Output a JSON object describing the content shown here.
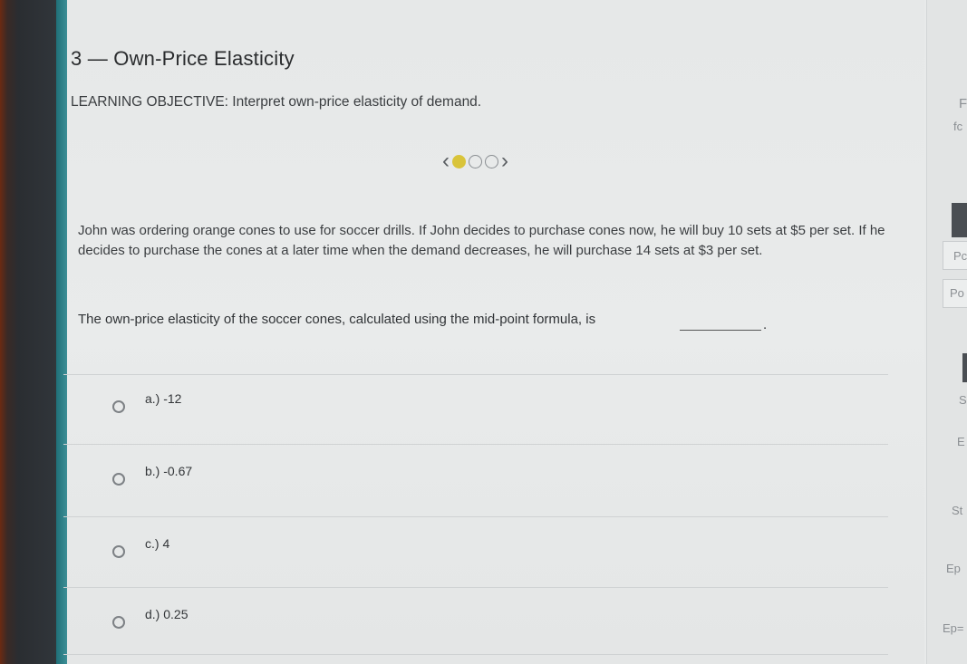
{
  "header": {
    "title": "3 — Own-Price Elasticity",
    "objective": "LEARNING OBJECTIVE: Interpret own-price elasticity of demand."
  },
  "pager": {
    "prev_icon": "‹",
    "next_icon": "›",
    "dots": 3,
    "active_index": 0
  },
  "question": {
    "text": "John was ordering orange cones to use for soccer drills. If John decides to purchase cones now, he will buy 10 sets at $5 per set. If he decides to purchase the cones at a later time when the demand decreases, he will purchase 14 sets at $3 per set.",
    "prompt": "The own-price elasticity of the soccer cones, calculated using the mid-point formula, is",
    "prompt_end": "."
  },
  "options": [
    {
      "label": "a.)  -12"
    },
    {
      "label": "b.)  -0.67"
    },
    {
      "label": "c.)  4"
    },
    {
      "label": "d.)  0.25"
    }
  ],
  "right_panel": {
    "t1": "F",
    "t2": "fc",
    "t3": "Pc",
    "t4": "Po",
    "t5": "S",
    "t6": "E",
    "t7": "St",
    "t8": "Ep",
    "t9": "Ep="
  },
  "colors": {
    "accent_dot": "#d9c43a",
    "teal_edge": "#1f6f78"
  }
}
